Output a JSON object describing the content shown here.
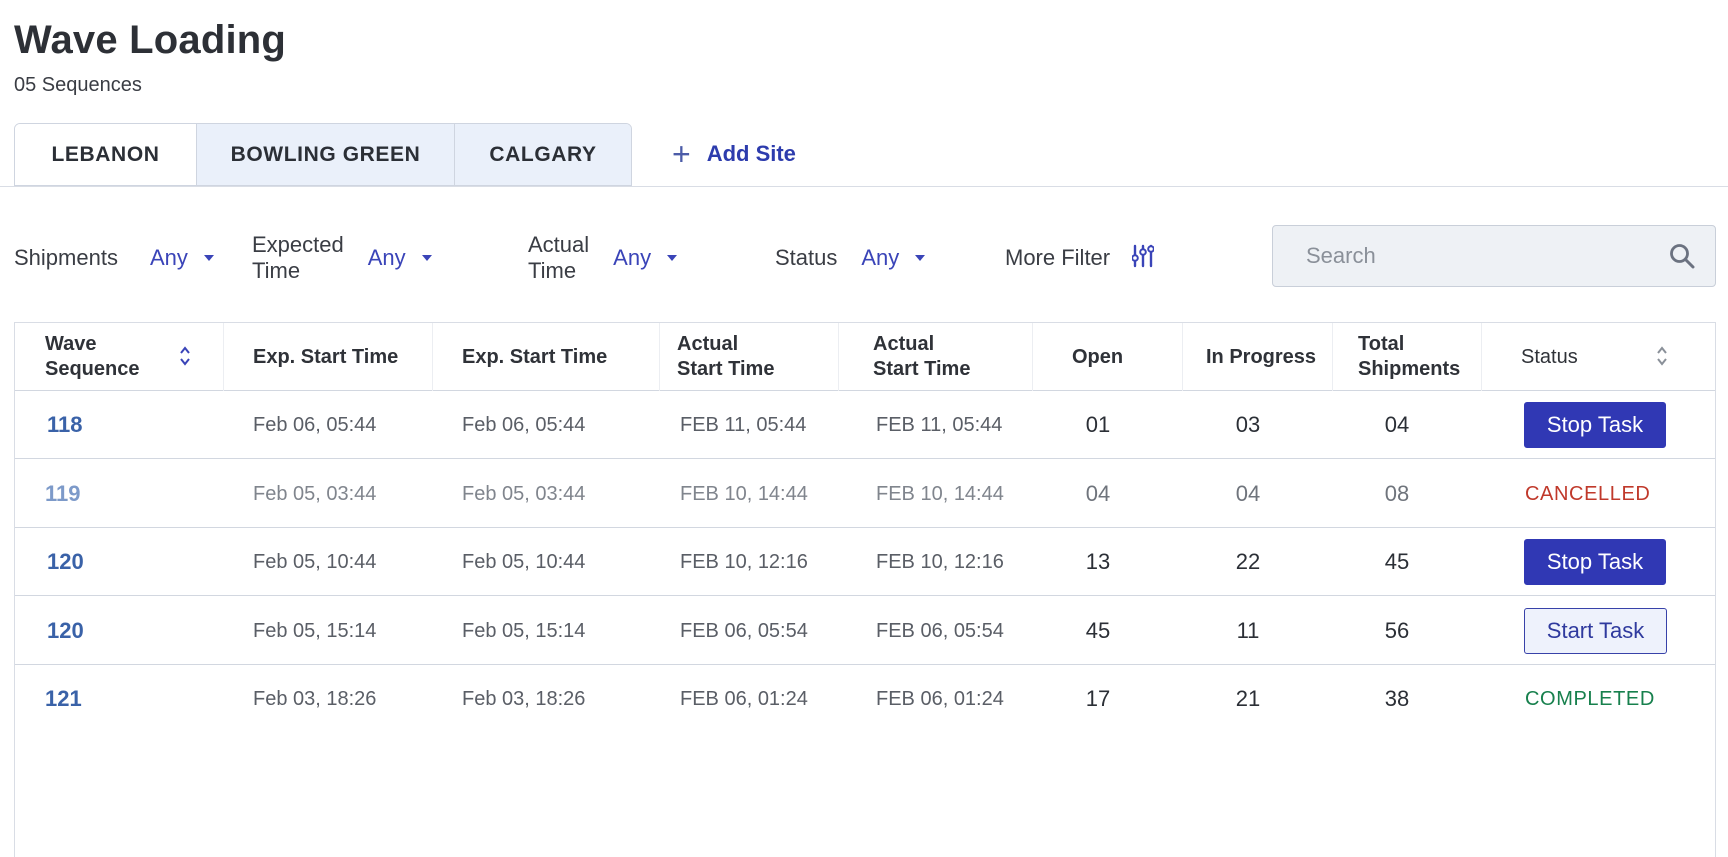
{
  "page": {
    "title": "Wave Loading",
    "subtitle": "05 Sequences"
  },
  "tabs": [
    "LEBANON",
    "BOWLING GREEN",
    "CALGARY"
  ],
  "add_site_label": "Add Site",
  "filters": [
    {
      "label": "Shipments",
      "value": "Any"
    },
    {
      "label": "Expected Time",
      "value": "Any"
    },
    {
      "label": "Actual Time",
      "value": "Any"
    },
    {
      "label": "Status",
      "value": "Any"
    }
  ],
  "more_filter_label": "More Filter",
  "search": {
    "placeholder": "Search",
    "value": ""
  },
  "table": {
    "headers": {
      "wave_sequence": "Wave Sequence",
      "exp_start_1": "Exp. Start Time",
      "exp_start_2": "Exp. Start Time",
      "actual_start_1": "Actual Start Time",
      "actual_start_2": "Actual Start Time",
      "open": "Open",
      "in_progress": "In Progress",
      "total_shipments": "Total Shipments",
      "status": "Status"
    },
    "rows": [
      {
        "seq": "118",
        "exp1": "Feb 06, 05:44",
        "exp2": "Feb 06, 05:44",
        "act1": "FEB 11, 05:44",
        "act2": "FEB 11, 05:44",
        "open": "01",
        "in_progress": "03",
        "total": "04",
        "status": "Stop Task",
        "status_kind": "stop"
      },
      {
        "seq": "119",
        "exp1": "Feb 05, 03:44",
        "exp2": "Feb 05, 03:44",
        "act1": "FEB 10, 14:44",
        "act2": "FEB 10, 14:44",
        "open": "04",
        "in_progress": "04",
        "total": "08",
        "status": "CANCELLED",
        "status_kind": "cancelled"
      },
      {
        "seq": "120",
        "exp1": "Feb 05, 10:44",
        "exp2": "Feb 05, 10:44",
        "act1": "FEB 10, 12:16",
        "act2": "FEB 10, 12:16",
        "open": "13",
        "in_progress": "22",
        "total": "45",
        "status": "Stop Task",
        "status_kind": "stop"
      },
      {
        "seq": "120",
        "exp1": "Feb 05, 15:14",
        "exp2": "Feb 05, 15:14",
        "act1": "FEB 06, 05:54",
        "act2": "FEB 06, 05:54",
        "open": "45",
        "in_progress": "11",
        "total": "56",
        "status": "Start Task",
        "status_kind": "start"
      },
      {
        "seq": "121",
        "exp1": "Feb 03, 18:26",
        "exp2": "Feb 03, 18:26",
        "act1": "FEB 06, 01:24",
        "act2": "FEB 06, 01:24",
        "open": "17",
        "in_progress": "21",
        "total": "38",
        "status": "COMPLETED",
        "status_kind": "completed"
      }
    ]
  },
  "colors": {
    "accent": "#3038b4",
    "link": "#3a62a8",
    "cancelled": "#c0392b",
    "completed": "#17804d",
    "tab_inactive_bg": "#eaf0fa"
  }
}
